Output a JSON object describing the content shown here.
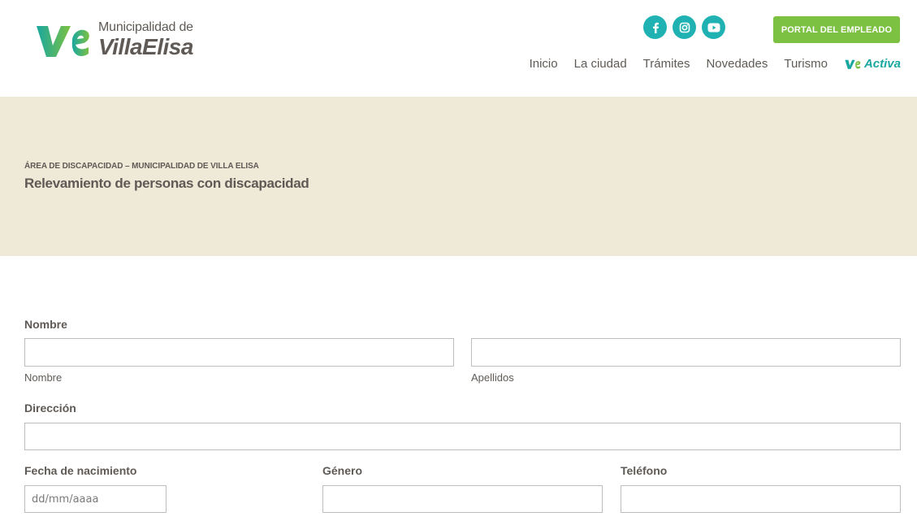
{
  "brand": {
    "name_top": "Municipalidad de",
    "name_bottom": "VillaElisa",
    "mark": "VE",
    "teal": "#1aa79f",
    "green": "#7cc142"
  },
  "socials": [
    {
      "name": "facebook",
      "icon": "facebook-icon"
    },
    {
      "name": "instagram",
      "icon": "instagram-icon"
    },
    {
      "name": "youtube",
      "icon": "youtube-icon"
    }
  ],
  "header": {
    "portal_label": "PORTAL DEL EMPLEADO"
  },
  "nav": {
    "items": [
      "Inicio",
      "La ciudad",
      "Trámites",
      "Novedades",
      "Turismo"
    ],
    "activa_label": "Activa"
  },
  "banner": {
    "kicker": "ÁREA DE DISCAPACIDAD – MUNICIPALIDAD DE VILLA ELISA",
    "title": "Relevamiento de personas con discapacidad"
  },
  "form": {
    "nombre_label": "Nombre",
    "first_name_sublabel": "Nombre",
    "last_name_sublabel": "Apellidos",
    "direccion_label": "Dirección",
    "fecha_label": "Fecha de nacimiento",
    "fecha_placeholder": "dd/mm/aaaa",
    "genero_label": "Género",
    "telefono_label": "Teléfono"
  }
}
